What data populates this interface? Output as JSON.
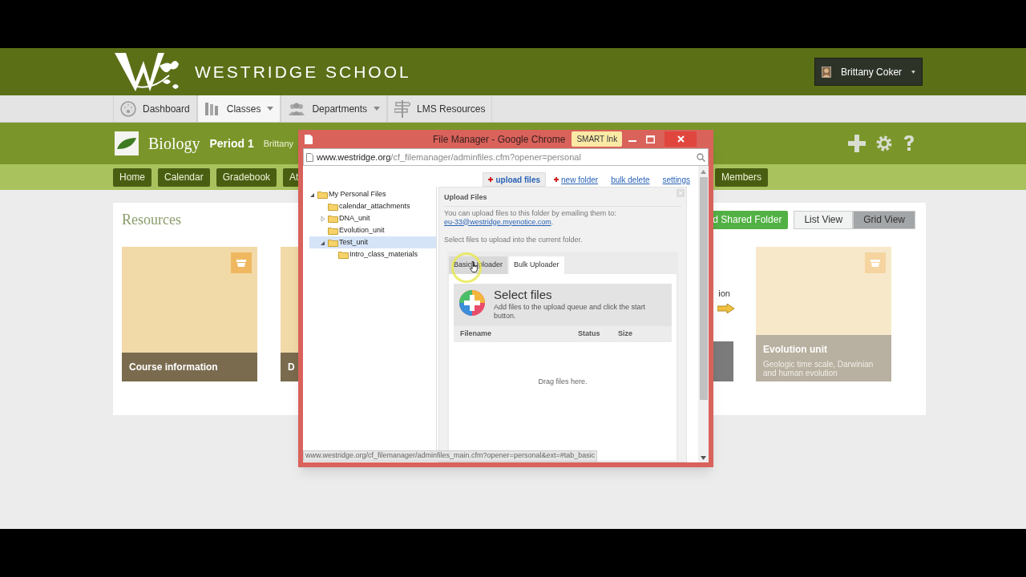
{
  "header": {
    "school_name": "WESTRIDGE SCHOOL",
    "user": {
      "name": "Brittany Coker"
    }
  },
  "main_nav": [
    {
      "label": "Dashboard",
      "dropdown": false,
      "selected": false
    },
    {
      "label": "Classes",
      "dropdown": true,
      "selected": true
    },
    {
      "label": "Departments",
      "dropdown": true,
      "selected": false
    },
    {
      "label": "LMS Resources",
      "dropdown": false,
      "selected": false
    }
  ],
  "class_header": {
    "title": "Biology",
    "period": "Period 1",
    "teacher": "Brittany"
  },
  "class_tabs": [
    "Home",
    "Calendar",
    "Gradebook",
    "At"
  ],
  "class_tabs_right": [
    "Members"
  ],
  "resources": {
    "title": "Resources",
    "add_shared_folder": "d Shared Folder",
    "views": [
      {
        "label": "List View",
        "selected": false
      },
      {
        "label": "Grid View",
        "selected": true
      }
    ],
    "cards": [
      {
        "kind": "folder",
        "title": "Course information",
        "faded": false
      },
      {
        "kind": "folder",
        "title": "D",
        "faded": false
      },
      {
        "kind": "image",
        "title": "ion",
        "faded": false
      },
      {
        "kind": "folder",
        "title": "Evolution unit",
        "description": "Geologic time scale, Darwinian and human evolution",
        "faded": true
      }
    ]
  },
  "popup": {
    "title": "File Manager - Google Chrome",
    "smart_ink": "SMART Ink",
    "url_host": "www.westridge.org",
    "url_path": "/cf_filemanager/adminfiles.cfm?opener=personal",
    "actions": [
      {
        "label": "upload files",
        "plus": true,
        "selected": true
      },
      {
        "label": "new folder",
        "plus": true,
        "selected": false
      },
      {
        "label": "bulk delete",
        "plus": false,
        "selected": false
      },
      {
        "label": "settings",
        "plus": false,
        "selected": false
      }
    ],
    "tree": [
      {
        "label": "My Personal Files",
        "expanded": true,
        "selected": false,
        "children": [
          {
            "label": "calendar_attachments",
            "selected": false
          },
          {
            "label": "DNA_unit",
            "expanded": false,
            "selected": false
          },
          {
            "label": "Evolution_unit",
            "selected": false
          },
          {
            "label": "Test_unit",
            "expanded": true,
            "selected": true,
            "children": [
              {
                "label": "Intro_class_materials",
                "selected": false
              }
            ]
          }
        ]
      }
    ],
    "upload": {
      "heading": "Upload Files",
      "email_note": "You can upload files to this folder by emailing them to:",
      "email": "eu-33@westridge.myenotice.com",
      "email_suffix": ".",
      "select_note": "Select files to upload into the current folder.",
      "tabs": [
        {
          "label": "Basic Uploader",
          "selected": false
        },
        {
          "label": "Bulk Uploader",
          "selected": true
        }
      ],
      "select_title": "Select files",
      "select_desc": "Add files to the upload queue and click the start button.",
      "columns": [
        "Filename",
        "Status",
        "Size"
      ],
      "drop_hint": "Drag files here."
    },
    "status_url": "www.westridge.org/cf_filemanager/adminfiles_main.cfm?opener=personal&ext=#tab_basic"
  }
}
